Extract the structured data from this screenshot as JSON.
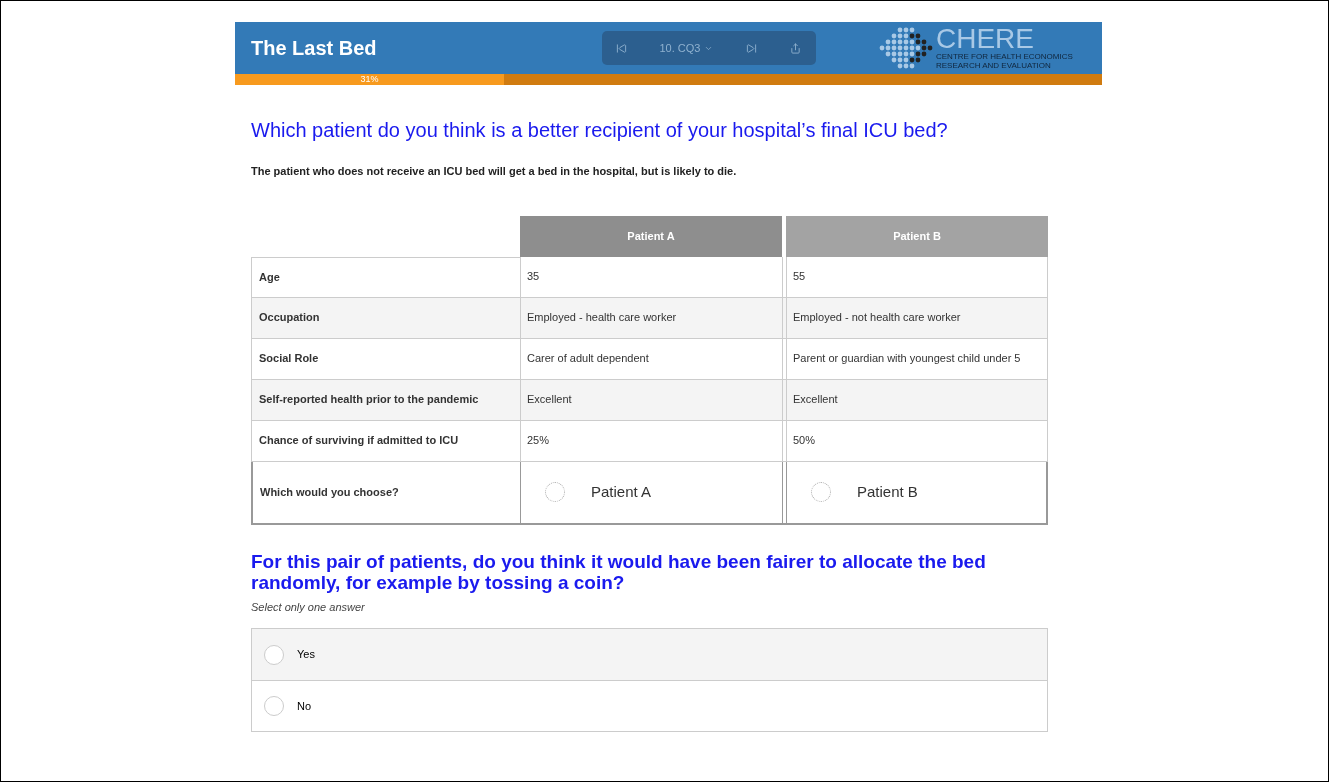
{
  "header": {
    "title": "The Last Bed",
    "nav": {
      "page": "10. CQ3"
    },
    "logo": {
      "name": "CHERE",
      "line1": "CENTRE FOR HEALTH ECONOMICS",
      "line2": "RESEARCH AND EVALUATION"
    }
  },
  "progress": {
    "level": 0.31,
    "label": "31%"
  },
  "question1": {
    "title": "Which patient do you think is a better recipient of your hospital’s final ICU bed?",
    "note": "The patient who does not receive an ICU bed will get a bed in the hospital, but is likely to die."
  },
  "table": {
    "columns": [
      "Patient A",
      "Patient B"
    ],
    "rows": [
      {
        "label": "Age",
        "cells": [
          "35",
          "55"
        ]
      },
      {
        "label": "Occupation",
        "cells": [
          "Employed - health care worker",
          "Employed - not health care worker"
        ]
      },
      {
        "label": "Social Role",
        "cells": [
          "Carer of adult dependent",
          "Parent or guardian with youngest child under 5"
        ]
      },
      {
        "label": "Self-reported health prior to the pandemic",
        "cells": [
          "Excellent",
          "Excellent"
        ]
      },
      {
        "label": "Chance of surviving if admitted to ICU",
        "cells": [
          "25%",
          "50%"
        ]
      }
    ],
    "choice": {
      "label": "Which would you choose?",
      "options": [
        {
          "label": "Patient A",
          "selected": false
        },
        {
          "label": "Patient B",
          "selected": false
        }
      ]
    }
  },
  "question2": {
    "title": "For this pair of patients, do you think it would have been fairer to allocate the bed randomly, for example by tossing a coin?",
    "hint": "Select only one answer",
    "options": [
      {
        "label": "Yes",
        "selected": false
      },
      {
        "label": "No",
        "selected": false
      }
    ]
  }
}
